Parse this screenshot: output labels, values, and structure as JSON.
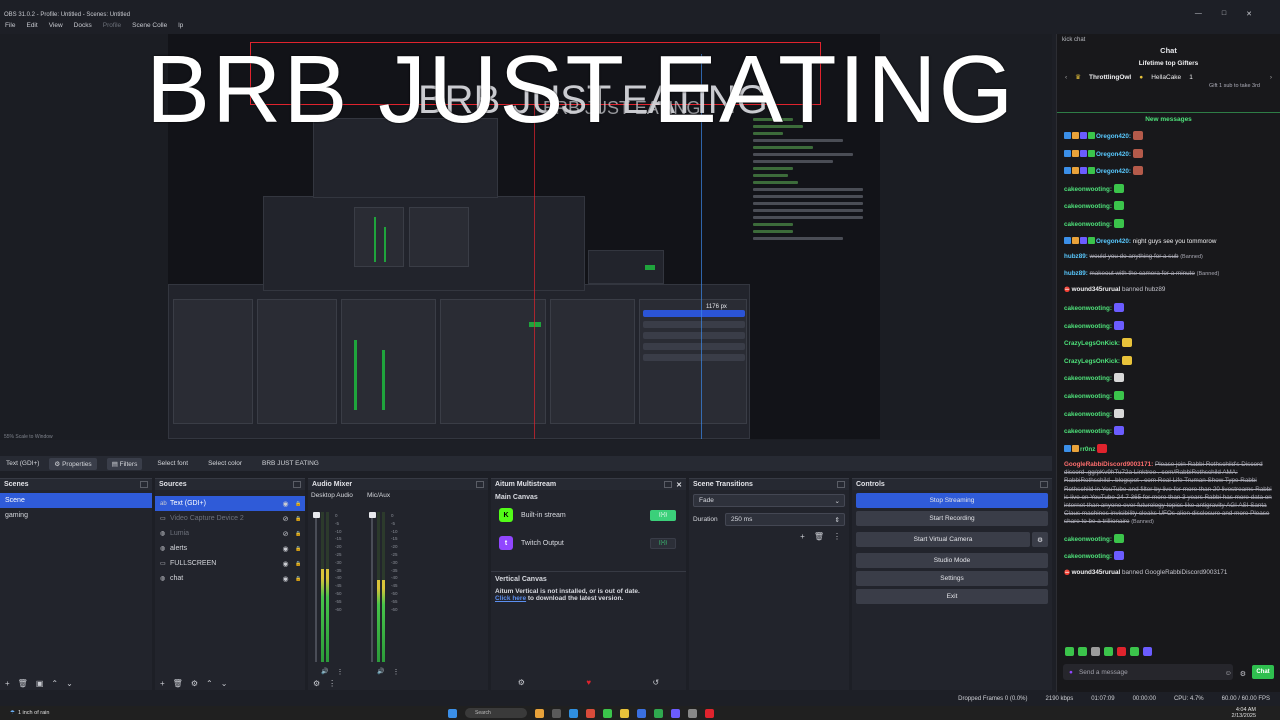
{
  "window": {
    "title": "OBS 31.0.2 - Profile: Untitled - Scenes: Untitled",
    "controls": [
      "—",
      "□",
      "✕"
    ]
  },
  "menu": {
    "items": [
      "File",
      "Edit",
      "View",
      "Docks",
      "Profile",
      "Scene Colle",
      "lp"
    ]
  },
  "preview": {
    "big_text": "BRB JUST EATING",
    "size_label": "1176 px",
    "zoom_label": "55%  Scale to Window"
  },
  "context_bar": {
    "source_name": "Text (GDI+)",
    "properties": "Properties",
    "filters": "Filters",
    "select_font": "Select font",
    "select_color": "Select color",
    "text_value": "BRB JUST EATING"
  },
  "scenes": {
    "title": "Scenes",
    "items": [
      {
        "label": "Scene",
        "selected": true
      },
      {
        "label": "gaming",
        "selected": false
      }
    ]
  },
  "sources": {
    "title": "Sources",
    "items": [
      {
        "label": "Text (GDI+)",
        "icon": "text-icon",
        "selected": true,
        "dim": false
      },
      {
        "label": "Video Capture Device 2",
        "icon": "camera-icon",
        "selected": false,
        "dim": true
      },
      {
        "label": "Lumia",
        "icon": "globe-icon",
        "selected": false,
        "dim": true
      },
      {
        "label": "alerts",
        "icon": "globe-icon",
        "selected": false,
        "dim": false
      },
      {
        "label": "FULLSCREEN",
        "icon": "monitor-icon",
        "selected": false,
        "dim": false
      },
      {
        "label": "chat",
        "icon": "globe-icon",
        "selected": false,
        "dim": false
      }
    ]
  },
  "mixer": {
    "title": "Audio Mixer",
    "channels": [
      {
        "name": "Desktop Audio",
        "level": 0.62
      },
      {
        "name": "Mic/Aux",
        "level": 0.55
      }
    ],
    "ticks": [
      "0",
      "-5",
      "-10",
      "-15",
      "-20",
      "-25",
      "-30",
      "-35",
      "-40",
      "-45",
      "-50",
      "-55",
      "-60"
    ]
  },
  "multistream": {
    "title": "Aitum Multistream",
    "main_canvas": "Main Canvas",
    "outputs": [
      {
        "name": "Built-in stream",
        "logo": "K",
        "color": "#53fc18",
        "status": "((•))",
        "active": true
      },
      {
        "name": "Twitch Output",
        "logo": "t",
        "color": "#9146ff",
        "status": "((•))",
        "active": false
      }
    ],
    "vertical_title": "Vertical Canvas",
    "vertical_msg": "Aitum Vertical is not installed, or is out of date.",
    "vertical_link": "Click here",
    "vertical_link_rest": " to download the latest version."
  },
  "transitions": {
    "title": "Scene Transitions",
    "selected": "Fade",
    "duration_label": "Duration",
    "duration_value": "250 ms"
  },
  "controls": {
    "title": "Controls",
    "buttons": [
      "Stop Streaming",
      "Start Recording",
      "Start Virtual Camera",
      "Studio Mode",
      "Settings",
      "Exit"
    ]
  },
  "chat": {
    "window_label": "kick chat",
    "title": "Chat",
    "gifters_title": "Lifetime top Gifters",
    "gifters": [
      {
        "name": "ThrottlingOwl",
        "count": ""
      },
      {
        "name": "HellaCake",
        "count": "1"
      }
    ],
    "gifters_sub": "Gift 1 sub to take 3rd",
    "new_messages": "New messages",
    "messages": [
      {
        "user": "Oregon420:",
        "color": "#59c9ff",
        "text": "",
        "emote": "#b45a4a",
        "badges": 4
      },
      {
        "user": "Oregon420:",
        "color": "#59c9ff",
        "text": "",
        "emote": "#b45a4a",
        "badges": 4
      },
      {
        "user": "Oregon420:",
        "color": "#59c9ff",
        "text": "",
        "emote": "#b45a4a",
        "badges": 4
      },
      {
        "user": "cakeonwooting:",
        "color": "#4ee27a",
        "text": "",
        "emote": "#3bc44b",
        "badges": 0
      },
      {
        "user": "cakeonwooting:",
        "color": "#4ee27a",
        "text": "",
        "emote": "#3bc44b",
        "badges": 0
      },
      {
        "user": "cakeonwooting:",
        "color": "#4ee27a",
        "text": "",
        "emote": "#3bc44b",
        "badges": 0
      },
      {
        "user": "Oregon420:",
        "color": "#59c9ff",
        "text": "night guys see you tommorow",
        "emote": "",
        "badges": 4
      },
      {
        "user": "hubz89:",
        "color": "#59c9ff",
        "text": "would you do anything for a sub",
        "emote": "",
        "badges": 0,
        "banned": "(Banned)",
        "strike": true
      },
      {
        "user": "hubz89:",
        "color": "#59c9ff",
        "text": "makeout with the camera for a minute",
        "emote": "",
        "badges": 0,
        "banned": "(Banned)",
        "strike": true
      },
      {
        "user": "wound345rurual",
        "color": "#efeff1",
        "text": "banned hubz89",
        "emote": "",
        "badges": 0,
        "mod": true
      },
      {
        "user": "cakeonwooting:",
        "color": "#4ee27a",
        "text": "",
        "emote": "#6b5cff",
        "badges": 0
      },
      {
        "user": "cakeonwooting:",
        "color": "#4ee27a",
        "text": "",
        "emote": "#6b5cff",
        "badges": 0
      },
      {
        "user": "CrazyLegsOnKick:",
        "color": "#4ee27a",
        "text": "",
        "emote": "#e8c23a",
        "badges": 0
      },
      {
        "user": "CrazyLegsOnKick:",
        "color": "#4ee27a",
        "text": "",
        "emote": "#e8c23a",
        "badges": 0
      },
      {
        "user": "cakeonwooting:",
        "color": "#4ee27a",
        "text": "",
        "emote": "#d8d8d8",
        "badges": 0
      },
      {
        "user": "cakeonwooting:",
        "color": "#4ee27a",
        "text": "",
        "emote": "#3bc44b",
        "badges": 0
      },
      {
        "user": "cakeonwooting:",
        "color": "#4ee27a",
        "text": "",
        "emote": "#d8d8d8",
        "badges": 0
      },
      {
        "user": "cakeonwooting:",
        "color": "#4ee27a",
        "text": "",
        "emote": "#6b5cff",
        "badges": 0
      },
      {
        "user": "rr0nz",
        "color": "#4ee27a",
        "text": "",
        "emote": "#e0232d",
        "badges": 2
      },
      {
        "user": "GoogleRabbiDiscord9003171:",
        "color": "#ff6e6e",
        "text": "Please join Rabbi Rothschild's Discord discord .gg/pKv9hTu72a Linktree . com/RabbiRothschild AMA: RabbiRothschild . blogspot . com Real Life Truman Show Type Rabbi Rothschild in YouTube and filter by live for more than 20 livestreams Rabbi is live on YouTube 24 7 365 for more than 3 years Rabbi has more data on internet than anyone ever futurology topics like antigravity AGI ASI Santa Claus machines invisibility cloaks UFOs alien disclosure and more Please share to be a trillionaire",
        "emote": "",
        "badges": 0,
        "banned": "(Banned)",
        "strike": true
      },
      {
        "user": "cakeonwooting:",
        "color": "#4ee27a",
        "text": "",
        "emote": "#3bc44b",
        "badges": 0
      },
      {
        "user": "cakeonwooting:",
        "color": "#4ee27a",
        "text": "",
        "emote": "#6b5cff",
        "badges": 0
      },
      {
        "user": "wound345rurual",
        "color": "#efeff1",
        "text": "banned GoogleRabbiDiscord9003171",
        "emote": "",
        "badges": 0,
        "mod": true
      }
    ],
    "input_placeholder": "Send a message",
    "send_label": "Chat"
  },
  "status": {
    "dropped": "Dropped Frames 0 (0.0%)",
    "bitrate": "2190 kbps",
    "stream_time": "01:07:09",
    "rec_time": "00:00:00",
    "cpu": "CPU: 4.7%",
    "fps": "60.00 / 60.00 FPS"
  },
  "taskbar": {
    "weather": "1 inch of rain",
    "search": "Search",
    "time": "4:04 AM",
    "date": "2/13/2025"
  }
}
